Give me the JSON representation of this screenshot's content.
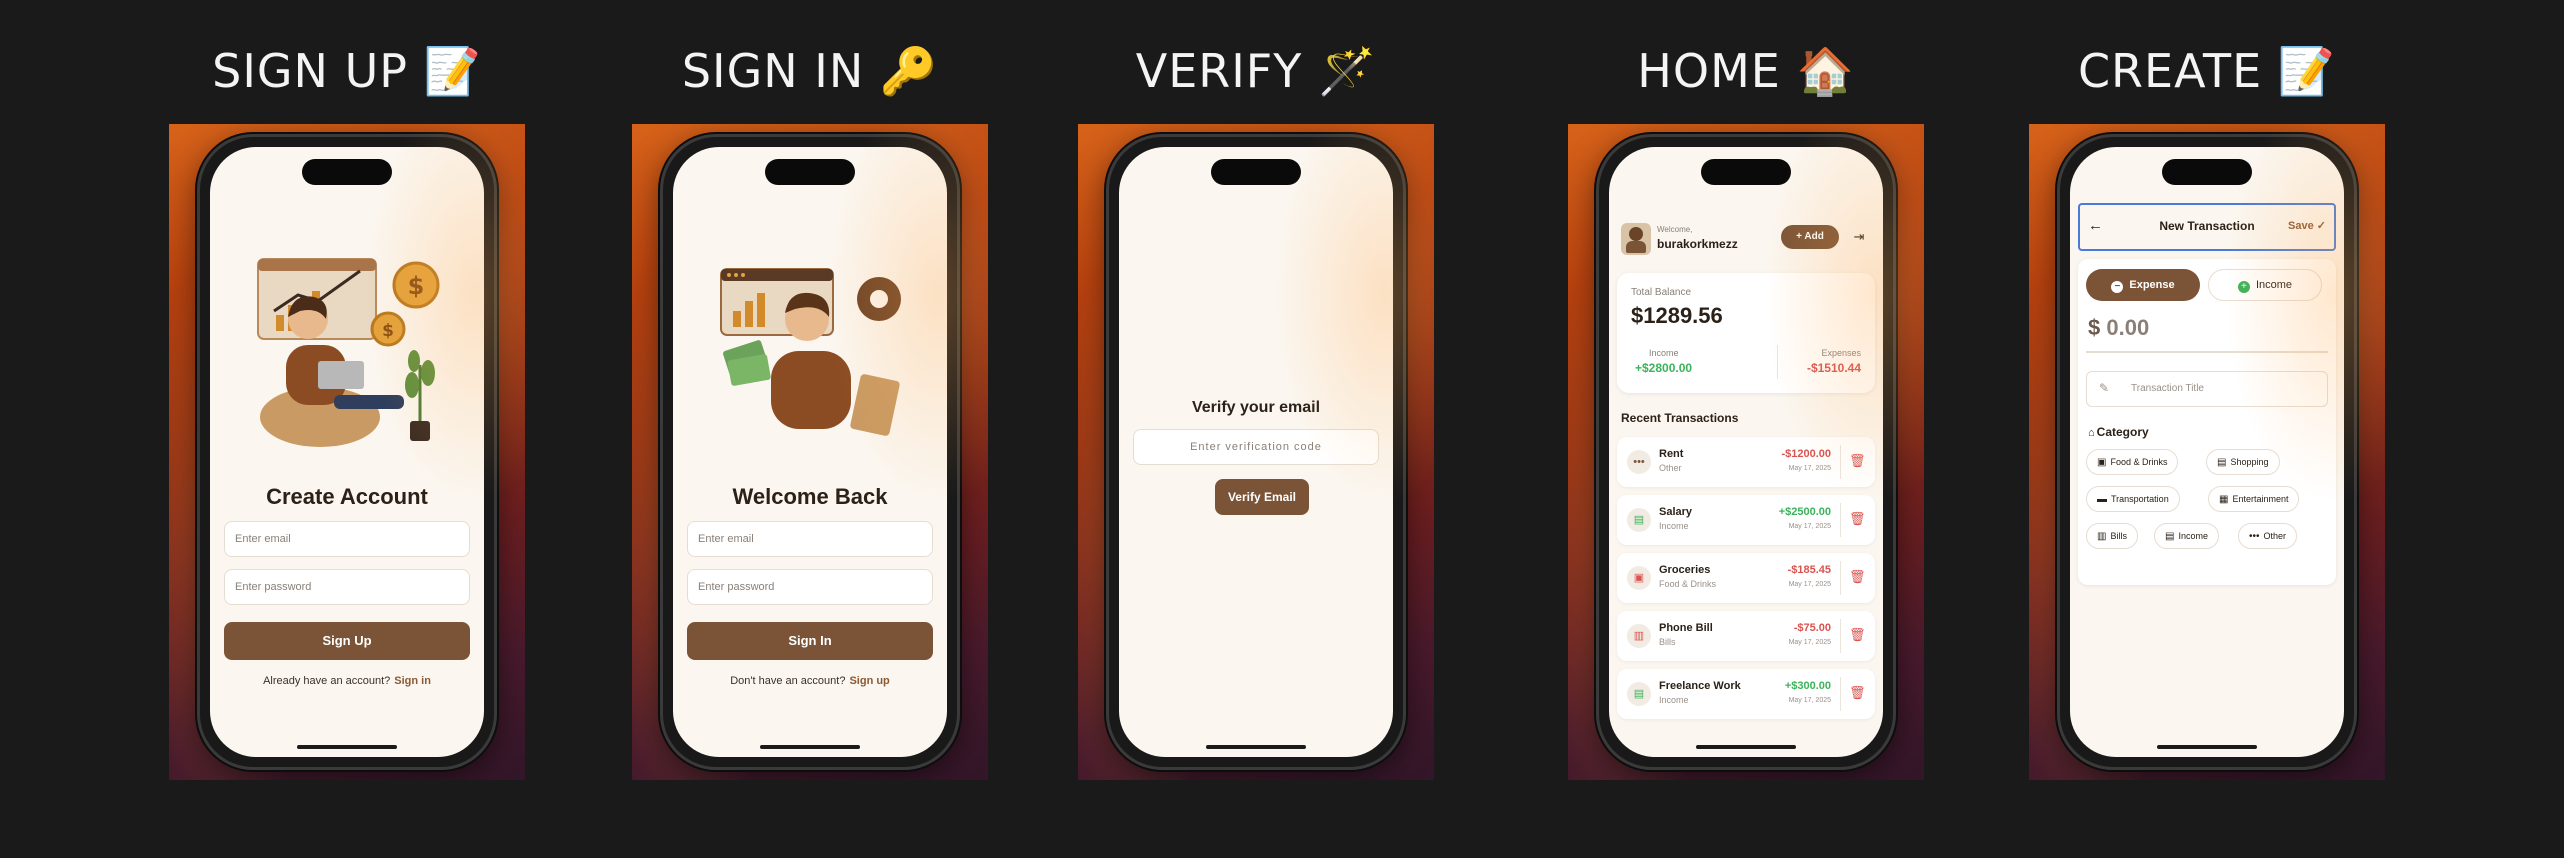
{
  "panels": {
    "signup": {
      "title": "SIGN UP 📝"
    },
    "signin": {
      "title": "SIGN IN 🔑"
    },
    "verify": {
      "title": "VERIFY 🪄"
    },
    "home": {
      "title": "HOME 🏠"
    },
    "create": {
      "title": "CREATE 📝"
    }
  },
  "signup": {
    "heading": "Create Account",
    "email_placeholder": "Enter email",
    "password_placeholder": "Enter password",
    "button": "Sign Up",
    "footer_text": "Already have an account?",
    "footer_link": "Sign in"
  },
  "signin": {
    "heading": "Welcome Back",
    "email_placeholder": "Enter email",
    "password_placeholder": "Enter password",
    "button": "Sign In",
    "footer_text": "Don't have an account?",
    "footer_link": "Sign up"
  },
  "verify": {
    "heading": "Verify your email",
    "code_placeholder": "Enter verification code",
    "button": "Verify Email"
  },
  "home": {
    "welcome": "Welcome,",
    "username": "burakorkmezz",
    "add_button": "Add",
    "balance_label": "Total Balance",
    "balance": "$1289.56",
    "income_label": "Income",
    "income": "+$2800.00",
    "expenses_label": "Expenses",
    "expenses": "-$1510.44",
    "recent_title": "Recent Transactions",
    "transactions": [
      {
        "name": "Rent",
        "category": "Other",
        "amount": "-$1200.00",
        "date": "May 17, 2025",
        "icon": "dots-icon",
        "sign": "neg"
      },
      {
        "name": "Salary",
        "category": "Income",
        "amount": "+$2500.00",
        "date": "May 17, 2025",
        "icon": "cash-icon",
        "sign": "pos"
      },
      {
        "name": "Groceries",
        "category": "Food & Drinks",
        "amount": "-$185.45",
        "date": "May 17, 2025",
        "icon": "cart-icon",
        "sign": "neg"
      },
      {
        "name": "Phone Bill",
        "category": "Bills",
        "amount": "-$75.00",
        "date": "May 17, 2025",
        "icon": "receipt-icon",
        "sign": "neg"
      },
      {
        "name": "Freelance Work",
        "category": "Income",
        "amount": "+$300.00",
        "date": "May 17, 2025",
        "icon": "cash-icon",
        "sign": "pos"
      }
    ]
  },
  "create": {
    "title": "New Transaction",
    "save": "Save",
    "expense": "Expense",
    "income": "Income",
    "amount_placeholder": "0.00",
    "currency": "$",
    "title_placeholder": "Transaction Title",
    "category_label": "Category",
    "categories": [
      "Food & Drinks",
      "Shopping",
      "Transportation",
      "Entertainment",
      "Bills",
      "Income",
      "Other"
    ]
  },
  "colors": {
    "brand_brown": "#7b5437",
    "screen_bg": "#fbf6ef",
    "negative": "#d9534f",
    "positive": "#3bb35a"
  }
}
